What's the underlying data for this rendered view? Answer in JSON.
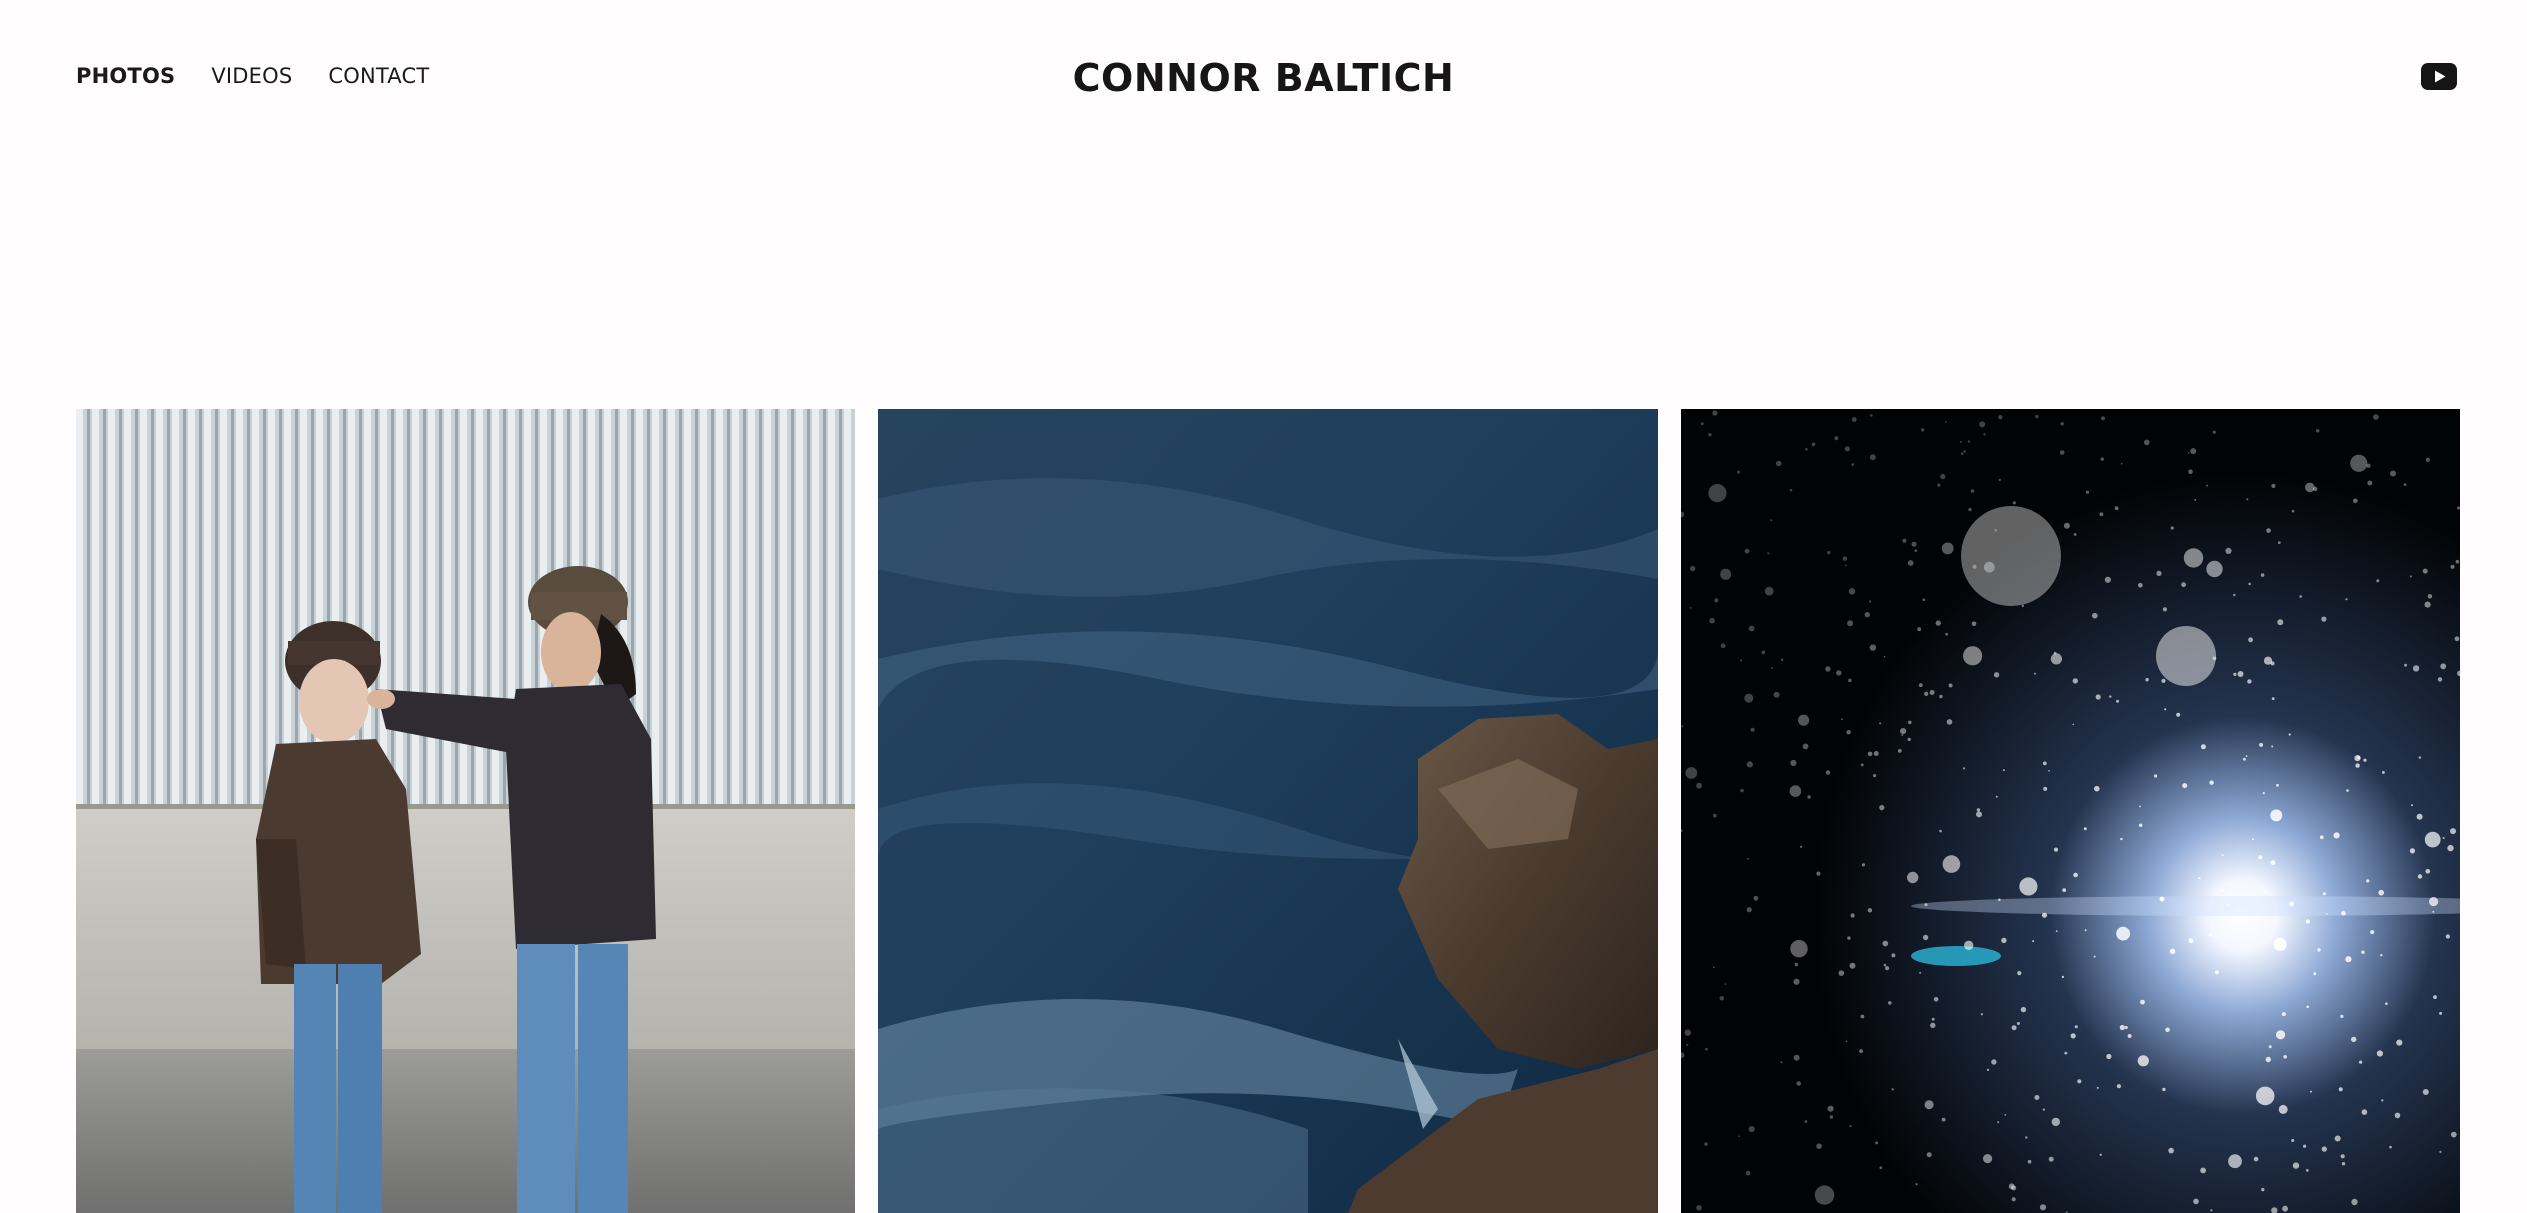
{
  "site": {
    "title": "CONNOR BALTICH"
  },
  "nav": {
    "items": [
      {
        "label": "PHOTOS",
        "active": true
      },
      {
        "label": "VIDEOS",
        "active": false
      },
      {
        "label": "CONTACT",
        "active": false
      }
    ]
  },
  "social": {
    "icon": "youtube-icon"
  },
  "gallery": {
    "photos": [
      {
        "subject": "two-people-beanies-wall"
      },
      {
        "subject": "water-over-rock"
      },
      {
        "subject": "starburst-particles"
      }
    ]
  },
  "colors": {
    "text": "#151515",
    "background": "#fffdfd"
  }
}
